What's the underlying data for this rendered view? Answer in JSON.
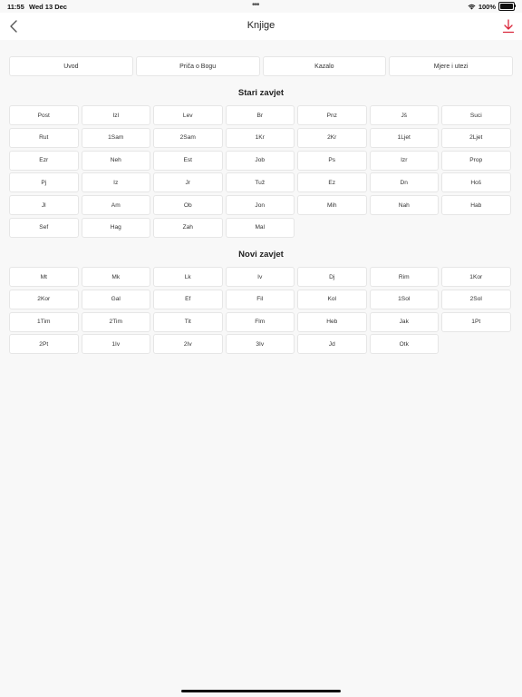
{
  "status": {
    "time": "11:55",
    "date": "Wed 13 Dec",
    "battery": "100%"
  },
  "nav": {
    "title": "Knjige"
  },
  "tabs": [
    "Uvod",
    "Priča o Bogu",
    "Kazalo",
    "Mjere i utezi"
  ],
  "sections": [
    {
      "title": "Stari zavjet",
      "books": [
        "Post",
        "Izl",
        "Lev",
        "Br",
        "Pnz",
        "Jš",
        "Suci",
        "Rut",
        "1Sam",
        "2Sam",
        "1Kr",
        "2Kr",
        "1Ljet",
        "2Ljet",
        "Ezr",
        "Neh",
        "Est",
        "Job",
        "Ps",
        "Izr",
        "Prop",
        "Pj",
        "Iz",
        "Jr",
        "Tuž",
        "Ez",
        "Dn",
        "Hoš",
        "Jl",
        "Am",
        "Ob",
        "Jon",
        "Mih",
        "Nah",
        "Hab",
        "Sef",
        "Hag",
        "Zah",
        "Mal"
      ]
    },
    {
      "title": "Novi zavjet",
      "books": [
        "Mt",
        "Mk",
        "Lk",
        "Iv",
        "Dj",
        "Rim",
        "1Kor",
        "2Kor",
        "Gal",
        "Ef",
        "Fil",
        "Kol",
        "1Sol",
        "2Sol",
        "1Tim",
        "2Tim",
        "Tit",
        "Flm",
        "Heb",
        "Jak",
        "1Pt",
        "2Pt",
        "1Iv",
        "2Iv",
        "3Iv",
        "Jd",
        "Otk"
      ]
    }
  ],
  "colors": {
    "accent": "#d9253a",
    "background": "#f8f8f8",
    "button_border": "#e6e6e6"
  },
  "icons": {
    "back": "chevron-left-icon",
    "download": "download-icon",
    "wifi": "wifi-icon",
    "battery": "battery-icon"
  }
}
